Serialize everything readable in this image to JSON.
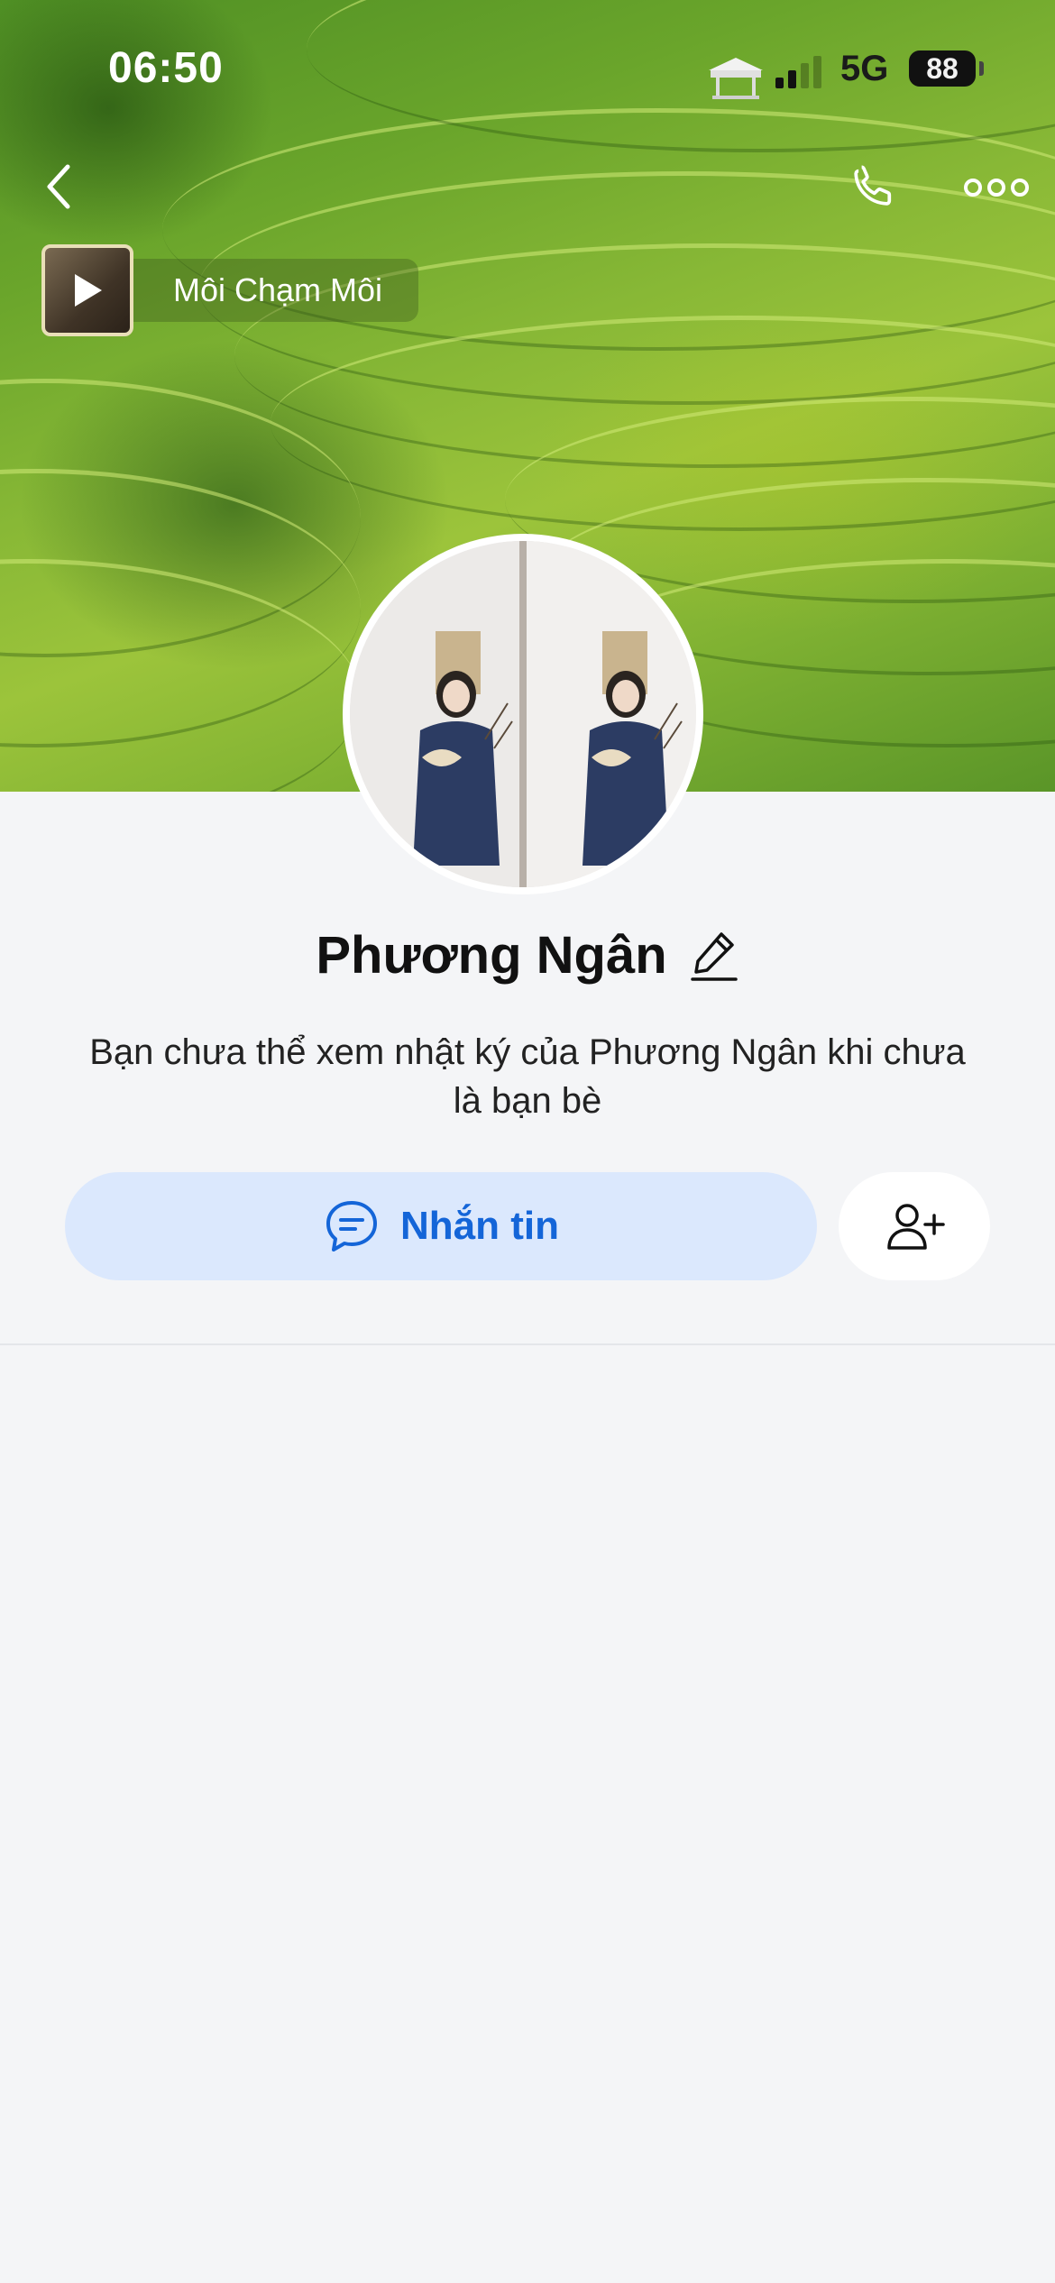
{
  "status_bar": {
    "time": "06:50",
    "network": "5G",
    "battery": "88"
  },
  "header": {
    "back_icon": "chevron-left-icon",
    "call_icon": "phone-icon",
    "more_icon": "more-horizontal-icon"
  },
  "music": {
    "title": "Môi Chạm Môi",
    "play_icon": "play-icon"
  },
  "profile": {
    "name": "Phương Ngân",
    "edit_icon": "pencil-icon",
    "notice": "Bạn chưa thể xem nhật ký của Phương Ngân khi chưa là bạn bè"
  },
  "actions": {
    "message_label": "Nhắn tin",
    "message_icon": "chat-bubble-icon",
    "add_friend_icon": "add-friend-icon"
  },
  "colors": {
    "accent": "#1465d8",
    "message_button_bg": "#dbe8fd",
    "page_bg": "#f4f5f7"
  }
}
